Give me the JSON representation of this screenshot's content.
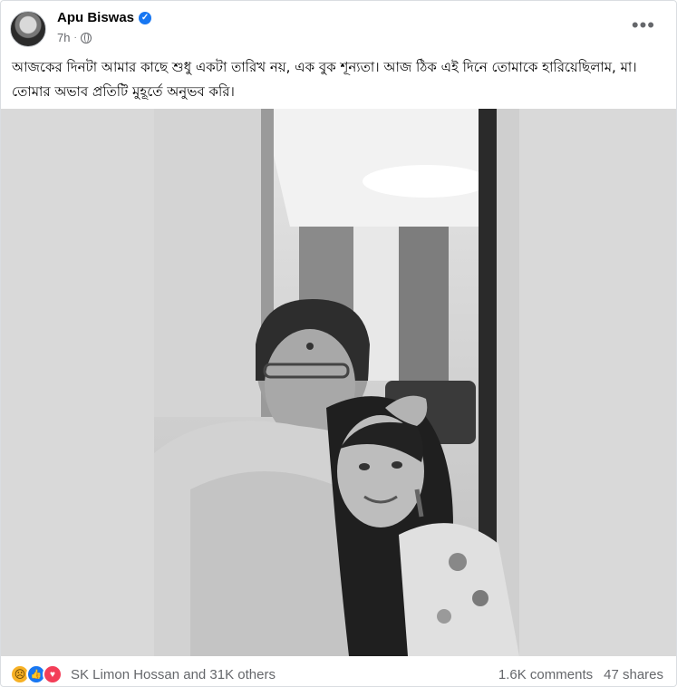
{
  "post": {
    "author": "Apu Biswas",
    "time": "7h",
    "caption": "আজকের দিনটা আমার কাছে শুধু একটা তারিখ নয়, এক বুক শূন্যতা। আজ ঠিক এই দিনে তোমাকে হারিয়েছিলাম, মা। তোমার অভাব প্রতিটি মুহূর্তে অনুভব করি।"
  },
  "reactions": {
    "icons": [
      "sad-emoji-icon",
      "like-icon",
      "love-icon"
    ],
    "summary": "SK Limon Hossan and 31K others"
  },
  "stats": {
    "comments": "1.6K comments",
    "shares": "47 shares"
  },
  "colors": {
    "like": "#1877f2",
    "love": "#f33e58",
    "sad": "#f7b125",
    "secondary_text": "#65676b"
  }
}
